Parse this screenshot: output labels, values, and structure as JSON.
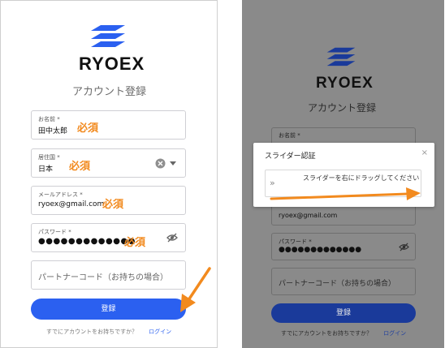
{
  "app": {
    "brand": "RYOEX",
    "page_title": "アカウント登録",
    "colors": {
      "accent": "#2b60f0",
      "required": "#f28a1e",
      "arrow": "#f28a1e",
      "dim": "#8a8a8a"
    }
  },
  "form": {
    "name": {
      "label": "お名前 *",
      "value": "田中太郎"
    },
    "country": {
      "label": "居住国 *",
      "value": "日本"
    },
    "email": {
      "label": "メールアドレス *",
      "value": "ryoex@gmail.com"
    },
    "password": {
      "label": "パスワード *",
      "value": "●●●●●●●●●●●●●"
    },
    "partner_code": {
      "placeholder": "パートナーコード（お持ちの場合）"
    },
    "submit_label": "登録",
    "footer_text": "すでにアカウントをお持ちですか？",
    "login_link": "ログイン"
  },
  "annotations": {
    "required": "必須"
  },
  "dialog": {
    "title": "スライダー認証",
    "close": "×",
    "slider_handle": "»",
    "slider_text": "スライダーを右にドラッグしてください"
  },
  "icons": {
    "clear": "clear-circle-icon",
    "dropdown": "caret-down-icon",
    "visibility": "eye-off-icon",
    "logo": "ryoex-wave-logo-icon"
  }
}
